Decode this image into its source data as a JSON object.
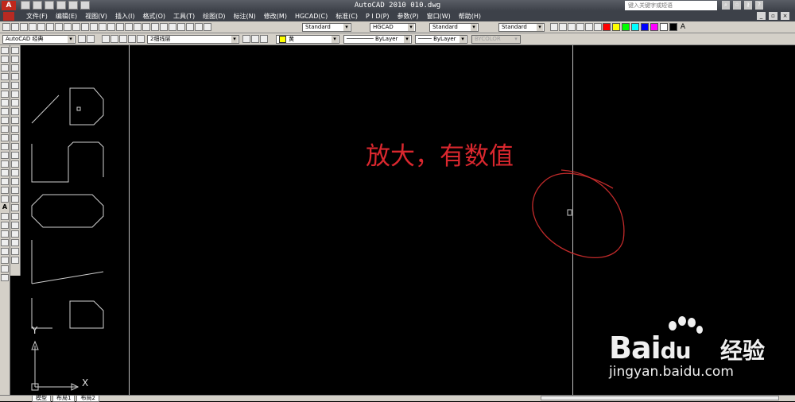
{
  "titlebar": {
    "app_title": "AutoCAD 2010   010.dwg",
    "logo_letter": "A",
    "search_placeholder": "键入关键字或短语"
  },
  "menu": {
    "items": [
      "文件(F)",
      "编辑(E)",
      "视图(V)",
      "插入(I)",
      "格式(O)",
      "工具(T)",
      "绘图(D)",
      "标注(N)",
      "修改(M)",
      "HGCAD(C)",
      "标准(C)",
      "P I D(P)",
      "参数(P)",
      "窗口(W)",
      "帮助(H)"
    ]
  },
  "toolbar": {
    "text_style": "Standard",
    "dim_style": "HGCAD",
    "table_style": "Standard",
    "mleader_style": "Standard",
    "workspace": "AutoCAD 经典",
    "layer": "2细线层",
    "color": "黄",
    "linetype": "ByLayer",
    "lineweight": "ByLayer",
    "plotstyle": "BYCOLOR",
    "text_tool_label": "A",
    "palette": [
      "#ff0000",
      "#ffff00",
      "#00ff00",
      "#00ffff",
      "#0000ff",
      "#ff00ff",
      "#ffffff",
      "#000000"
    ],
    "accent_color": "#c0281c"
  },
  "drawing": {
    "annotation_text": "放大，有数值",
    "annotation_color": "#d9272e",
    "ucs_y": "Y",
    "ucs_x": "X",
    "line_color": "#d0d0d0"
  },
  "watermark": {
    "brand_text": "Bai",
    "brand_du": "du",
    "brand_cn": "经验",
    "url": "jingyan.baidu.com"
  },
  "status": {
    "tabs": [
      "模型",
      "布局1",
      "布局2"
    ]
  },
  "icons": {
    "titlebar": [
      "new-icon",
      "open-icon",
      "save-icon",
      "undo-icon",
      "redo-icon",
      "print-icon"
    ],
    "search": "search-icon",
    "topright": [
      "binoculars-icon",
      "star-icon",
      "key-icon",
      "help-icon"
    ]
  }
}
